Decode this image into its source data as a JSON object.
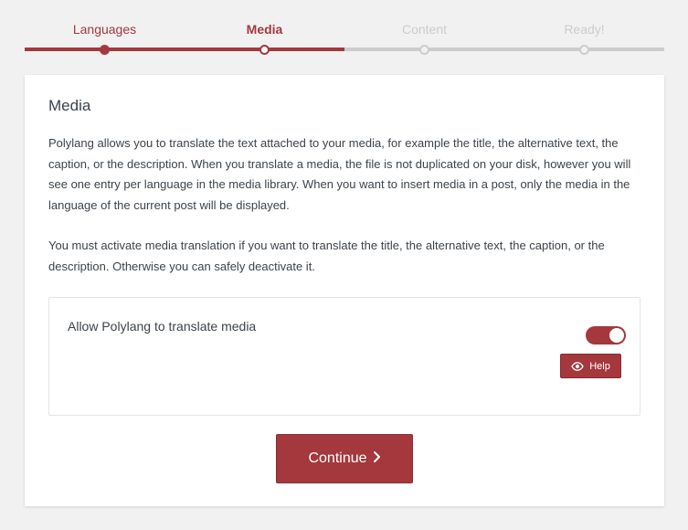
{
  "stepper": {
    "steps": [
      {
        "label": "Languages",
        "state": "done"
      },
      {
        "label": "Media",
        "state": "active"
      },
      {
        "label": "Content",
        "state": "pending"
      },
      {
        "label": "Ready!",
        "state": "pending"
      }
    ]
  },
  "card": {
    "title": "Media",
    "paragraph_1": "Polylang allows you to translate the text attached to your media, for example the title, the alternative text, the caption, or the description. When you translate a media, the file is not duplicated on your disk, however you will see one entry per language in the media library. When you want to insert media in a post, only the media in the language of the current post will be displayed.",
    "paragraph_2": "You must activate media translation if you want to translate the title, the alternative text, the caption, or the description. Otherwise you can safely deactivate it.",
    "option": {
      "label": "Allow Polylang to translate media",
      "enabled": true,
      "help_label": "Help"
    },
    "continue_label": "Continue"
  },
  "colors": {
    "accent": "#a4383d",
    "inactive": "#cccccc",
    "background": "#f1f1f1",
    "card": "#ffffff",
    "text": "#3c434a"
  },
  "icons": {
    "help": "eye-icon",
    "continue": "chevron-right-icon"
  }
}
